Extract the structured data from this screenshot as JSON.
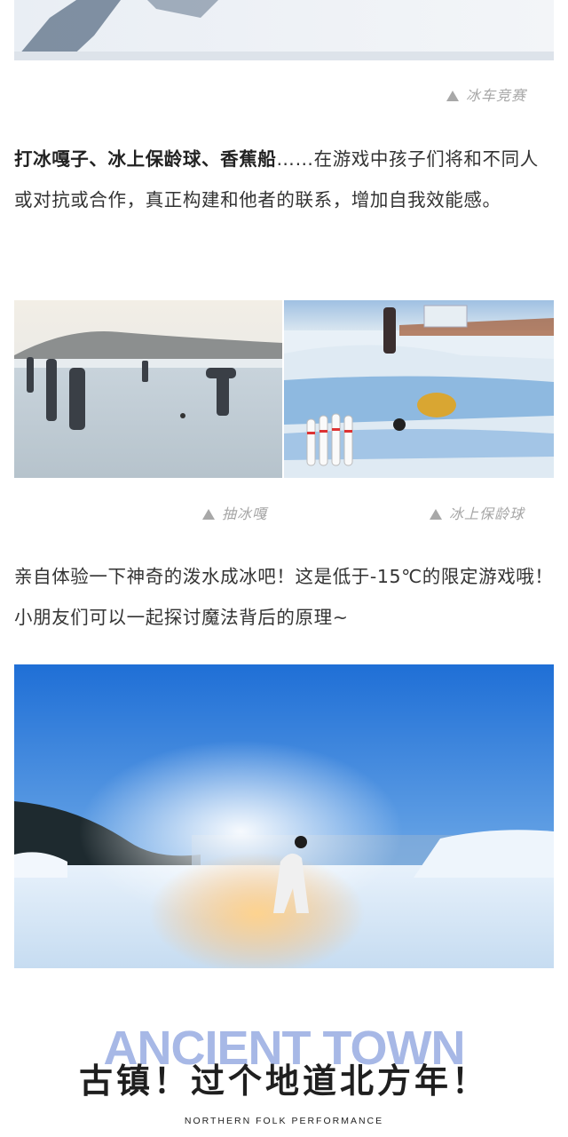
{
  "captions": {
    "ice_car_race": "冰车竞赛",
    "ice_top": "抽冰嘎",
    "ice_bowling": "冰上保龄球"
  },
  "paragraph1": {
    "bold": "打冰嘎子、冰上保龄球、香蕉船",
    "rest": "……在游戏中孩子们将和不同人或对抗或合作，真正构建和他者的联系，增加自我效能感。"
  },
  "paragraph2": {
    "text": "亲自体验一下神奇的泼水成冰吧！这是低于-15℃的限定游戏哦！小朋友们可以一起探讨魔法背后的原理~"
  },
  "section_header": {
    "english": "ANCIENT TOWN",
    "chinese": "古镇！过个地道北方年！",
    "subtitle": "NORTHERN FOLK PERFORMANCE"
  },
  "colors": {
    "english_title": "#a7b8e6",
    "caption": "#a6a6a6"
  }
}
